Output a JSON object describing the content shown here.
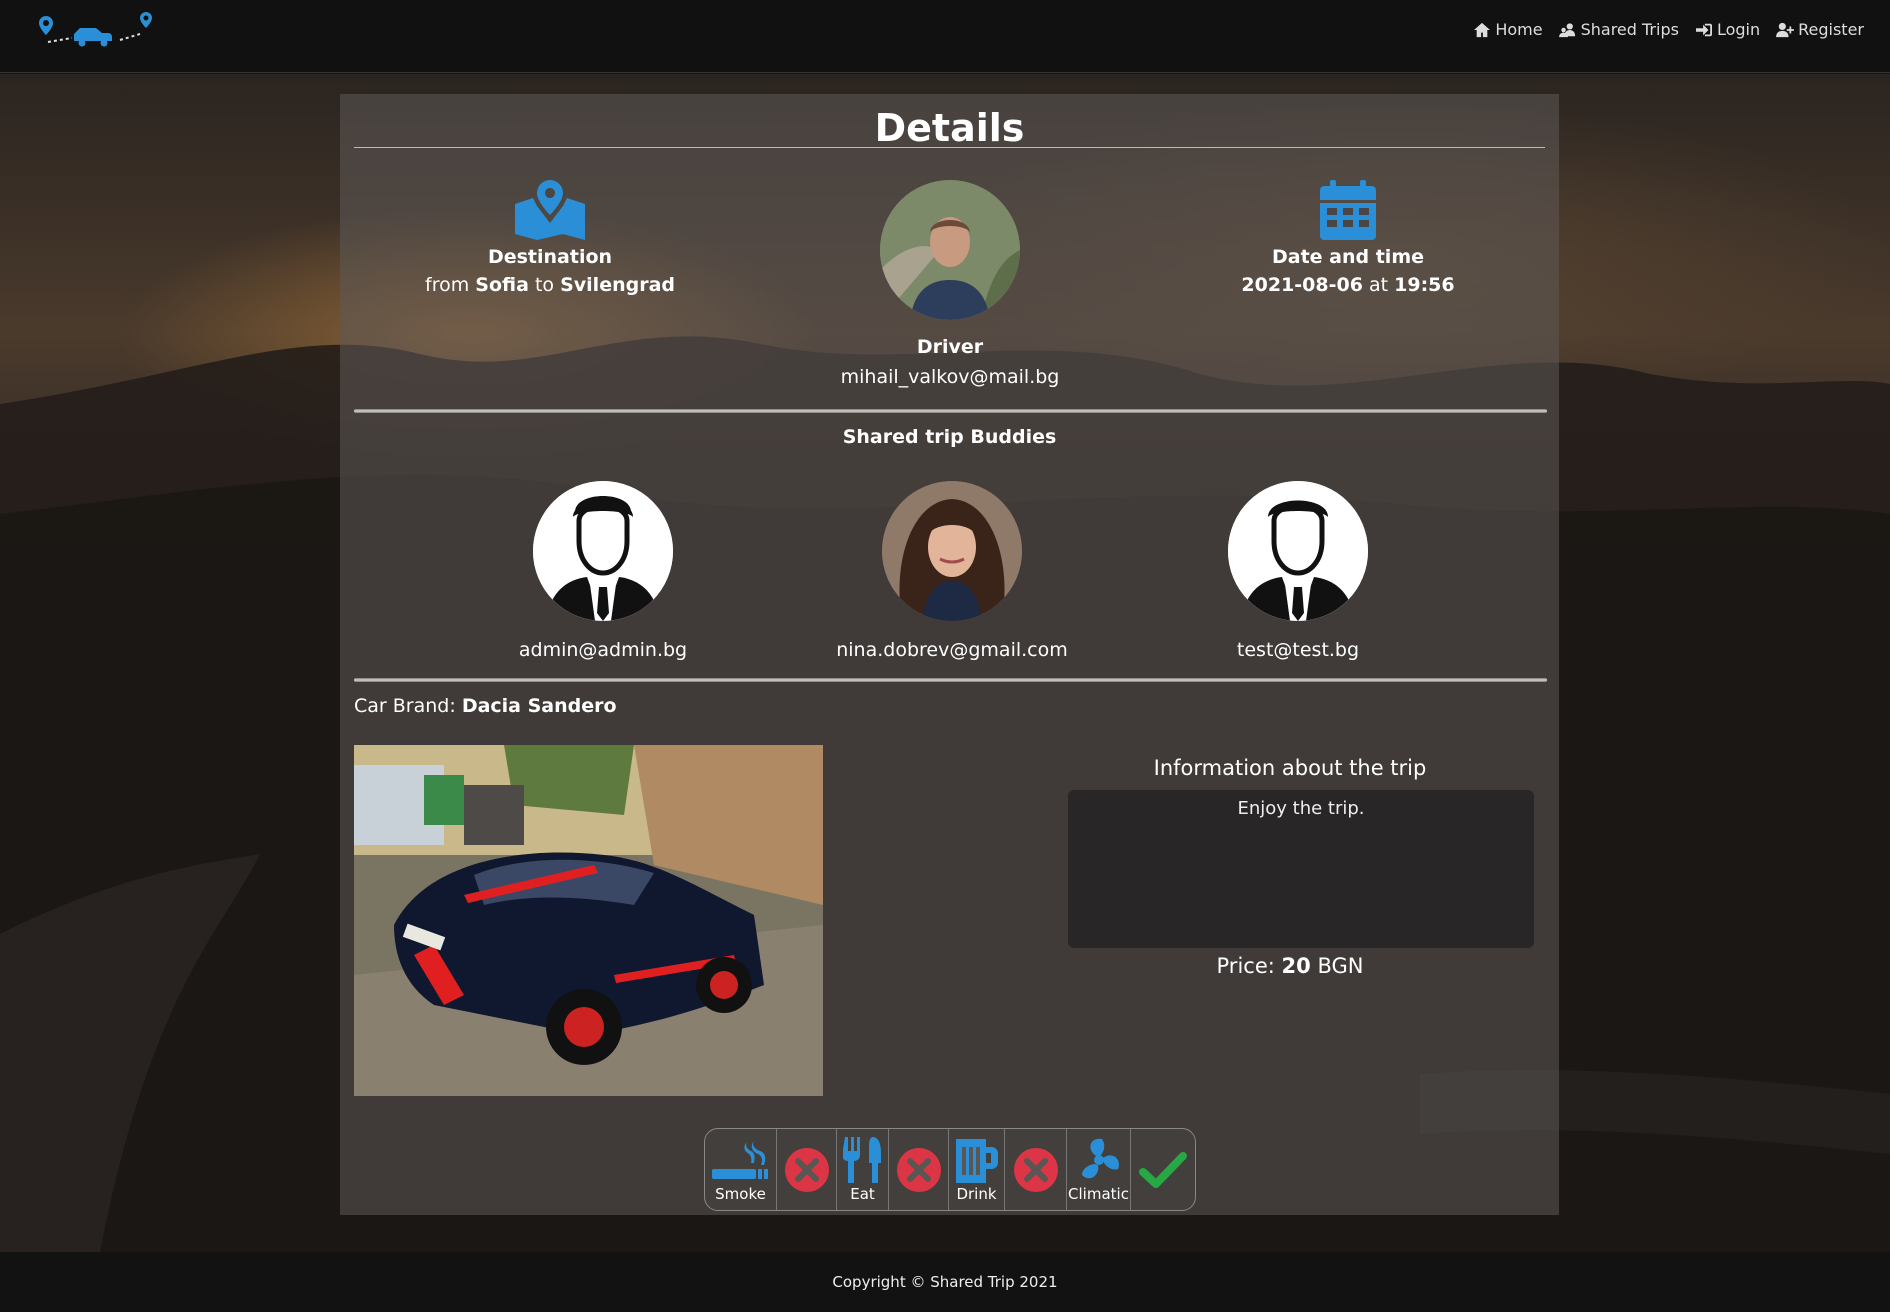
{
  "nav": {
    "logo_alt": "Shared Trip",
    "links": [
      {
        "label": "Home",
        "icon": "home-icon"
      },
      {
        "label": "Shared Trips",
        "icon": "users-icon"
      },
      {
        "label": "Login",
        "icon": "login-icon"
      },
      {
        "label": "Register",
        "icon": "user-plus-icon"
      }
    ]
  },
  "page": {
    "title": "Details"
  },
  "destination": {
    "heading": "Destination",
    "from_word": "from",
    "from": "Sofia",
    "to_word": "to",
    "to": "Svilengrad",
    "icon": "map-pin-icon"
  },
  "driver": {
    "heading": "Driver",
    "email": "mihail_valkov@mail.bg"
  },
  "datetime": {
    "heading": "Date and time",
    "date": "2021-08-06",
    "at_word": "at",
    "time": "19:56",
    "icon": "calendar-icon"
  },
  "buddies": {
    "title": "Shared trip Buddies",
    "items": [
      {
        "email": "admin@admin.bg",
        "avatar": "default-avatar"
      },
      {
        "email": "nina.dobrev@gmail.com",
        "avatar": "photo-avatar"
      },
      {
        "email": "test@test.bg",
        "avatar": "default-avatar"
      }
    ]
  },
  "car": {
    "label": "Car Brand:",
    "brand": "Dacia Sandero"
  },
  "info": {
    "title": "Information about the trip",
    "text": "Enjoy the trip.",
    "price_label": "Price:",
    "price_value": "20",
    "currency": "BGN"
  },
  "amenities": [
    {
      "label": "Smoke",
      "icon": "smoking-icon",
      "allowed": false
    },
    {
      "label": "Eat",
      "icon": "utensils-icon",
      "allowed": false
    },
    {
      "label": "Drink",
      "icon": "beer-icon",
      "allowed": false
    },
    {
      "label": "Climatic",
      "icon": "fan-icon",
      "allowed": true
    }
  ],
  "colors": {
    "accent_blue": "#2a8fd6",
    "denied_red": "#dc3545",
    "allowed_green": "#28a745"
  },
  "footer": {
    "text": "Copyright © Shared Trip 2021"
  }
}
